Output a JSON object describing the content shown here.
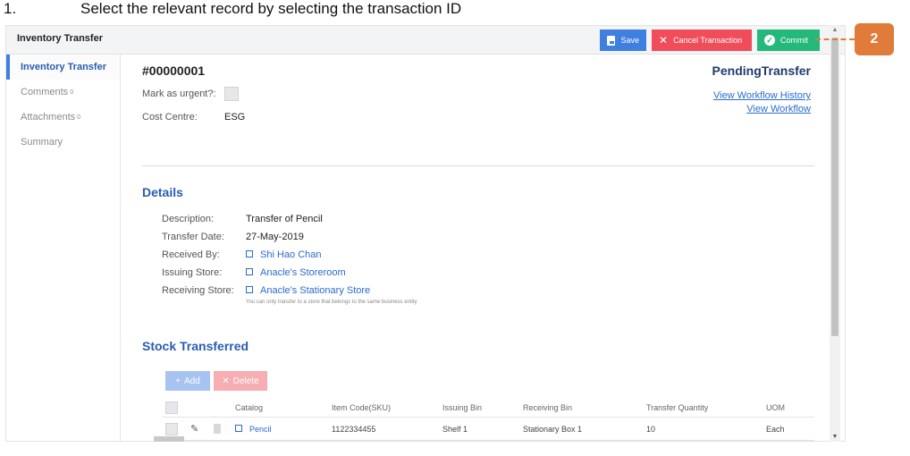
{
  "instruction": {
    "number": "1.",
    "text": "Select the relevant record by selecting the transaction ID"
  },
  "app": {
    "title": "Inventory Transfer",
    "toolbar": {
      "save_label": "Save",
      "cancel_label": "Cancel Transaction",
      "commit_label": "Commit"
    }
  },
  "sidebar": {
    "items": [
      {
        "label": "Inventory Transfer",
        "count": ""
      },
      {
        "label": "Comments",
        "count": "0"
      },
      {
        "label": "Attachments",
        "count": "0"
      },
      {
        "label": "Summary",
        "count": ""
      }
    ]
  },
  "record": {
    "id": "#00000001",
    "status": "PendingTransfer",
    "urgent_label": "Mark as urgent?:",
    "cost_centre_label": "Cost Centre:",
    "cost_centre_value": "ESG",
    "workflow_history_link": "View Workflow History",
    "workflow_link": "View Workflow"
  },
  "details": {
    "title": "Details",
    "description_label": "Description:",
    "description_value": "Transfer of Pencil",
    "date_label": "Transfer Date:",
    "date_value": "27-May-2019",
    "received_by_label": "Received By:",
    "received_by_value": "Shi Hao Chan",
    "issuing_store_label": "Issuing Store:",
    "issuing_store_value": "Anacle's Storeroom",
    "receiving_store_label": "Receiving Store:",
    "receiving_store_value": "Anacle's Stationary Store",
    "receiving_store_hint": "You can only transfer to a store that belongs to the same business entity"
  },
  "stock": {
    "title": "Stock Transferred",
    "add_label": "Add",
    "delete_label": "Delete",
    "columns": [
      "Catalog",
      "Item Code(SKU)",
      "Issuing Bin",
      "Receiving Bin",
      "Transfer Quantity",
      "UOM"
    ],
    "rows": [
      {
        "catalog": "Pencil",
        "sku": "1122334455",
        "issuing_bin": "Shelf 1",
        "receiving_bin": "Stationary Box 1",
        "quantity": "10",
        "uom": "Each"
      }
    ]
  },
  "callout": {
    "label": "2",
    "color": "#e07b39"
  },
  "colors": {
    "save": "#3f7fe0",
    "cancel": "#ef4d5a",
    "commit": "#24b97a",
    "link": "#2a6bd1"
  }
}
